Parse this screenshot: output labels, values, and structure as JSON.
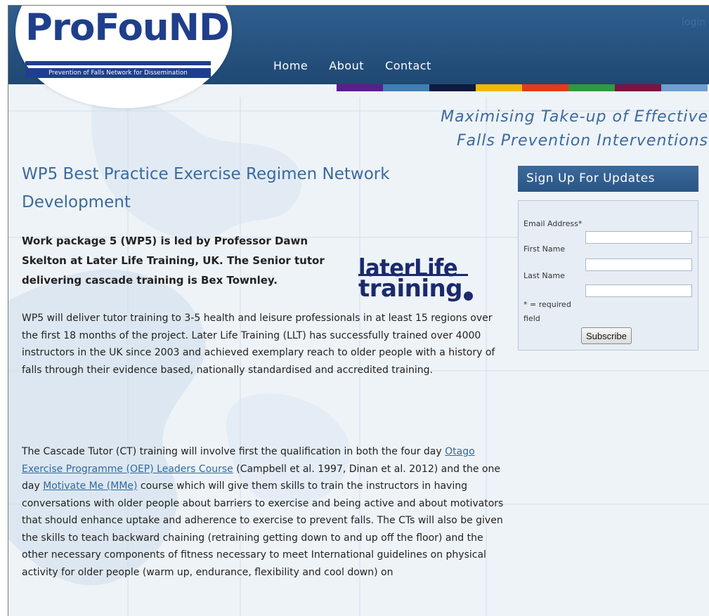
{
  "header": {
    "login_label": "login",
    "logo": {
      "wordmark": "ProFouND",
      "tagline": "Prevention of Falls Network for Dissemination"
    },
    "nav": [
      "Home",
      "About",
      "Contact"
    ],
    "strip_colors": [
      "#5a1e8c",
      "#3f7fb3",
      "#0f1a3f",
      "#f2b705",
      "#e23a1b",
      "#2e9a3e",
      "#7d1240",
      "#6fa0d0"
    ]
  },
  "tagline": {
    "line1": "Maximising Take-up of Effective",
    "line2": "Falls Prevention Interventions"
  },
  "article": {
    "title": "WP5 Best Practice Exercise Regimen Network Development",
    "lead": "Work package 5 (WP5) is led by Professor Dawn Skelton at Later Life Training, UK. The Senior tutor delivering cascade training is Bex Townley.",
    "partner_logo": {
      "line1": "laterLife",
      "line2": "training"
    },
    "p1": "WP5 will deliver tutor training to 3-5 health and leisure professionals in at least 15 regions over the first 18 months of the project. Later Life Training (LLT) has successfully trained over 4000 instructors in the UK since 2003 and achieved exemplary reach to older people with a history of falls through their evidence based, nationally standardised and accredited training.",
    "p2": {
      "text_a": "The Cascade Tutor (CT) training will involve first the qualification in both the four day ",
      "link_a": "Otago Exercise Programme (OEP) Leaders Course",
      "text_b": " (Campbell et al. 1997, Dinan et al. 2012) and the one day ",
      "link_b": "Motivate Me (MMe)",
      "text_c": " course which will give them skills to train the instructors in having conversations with older people about barriers to exercise and being active and about motivators that should enhance uptake and adherence to exercise to prevent falls. The CTs will also be given the skills to teach backward chaining (retraining getting down to and up off the floor) and the other necessary components of fitness necessary to meet International guidelines on physical activity for older people (warm up, endurance, flexibility and cool down) on"
    }
  },
  "signup": {
    "heading": "Sign Up For Updates",
    "email_label": "Email Address*",
    "first_name_label": "First Name",
    "last_name_label": "Last Name",
    "required_note": "* = required field",
    "subscribe_label": "Subscribe"
  }
}
